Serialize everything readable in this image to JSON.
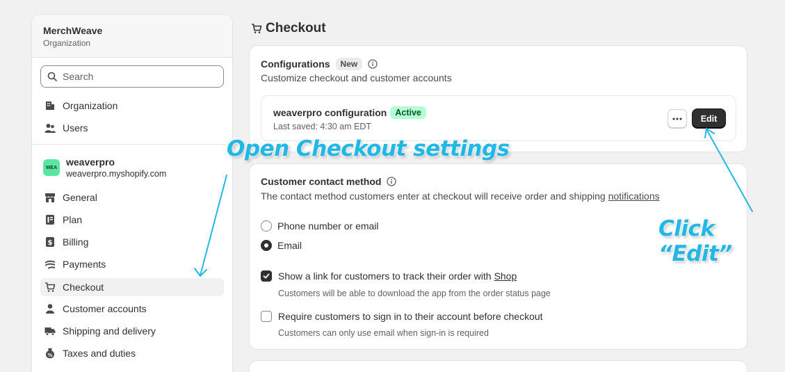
{
  "sidebar": {
    "org_name": "MerchWeave",
    "org_subtitle": "Organization",
    "search_placeholder": "Search",
    "top_items": [
      {
        "label": "Organization",
        "icon": "building-icon"
      },
      {
        "label": "Users",
        "icon": "users-icon"
      }
    ],
    "store": {
      "badge": "WEA",
      "name": "weaverpro",
      "domain": "weaverpro.myshopify.com",
      "badge_color": "#5ae6a0"
    },
    "store_items": [
      {
        "label": "General",
        "icon": "store-icon"
      },
      {
        "label": "Plan",
        "icon": "plan-icon"
      },
      {
        "label": "Billing",
        "icon": "billing-icon"
      },
      {
        "label": "Payments",
        "icon": "payments-icon"
      },
      {
        "label": "Checkout",
        "icon": "cart-icon",
        "active": true
      },
      {
        "label": "Customer accounts",
        "icon": "person-icon"
      },
      {
        "label": "Shipping and delivery",
        "icon": "truck-icon"
      },
      {
        "label": "Taxes and duties",
        "icon": "taxes-icon"
      }
    ]
  },
  "main": {
    "page_title": "Checkout",
    "configurations": {
      "title": "Configurations",
      "new_badge": "New",
      "subtitle": "Customize checkout and customer accounts",
      "config_name": "weaverpro configuration",
      "status_badge": "Active",
      "last_saved": "Last saved: 4:30 am EDT",
      "edit_label": "Edit"
    },
    "contact": {
      "title": "Customer contact method",
      "description": "The contact method customers enter at checkout will receive order and shipping",
      "description_link": "notifications",
      "options": [
        "Phone number or email",
        "Email"
      ],
      "selected": "Email",
      "shop_link_label": "Show a link for customers to track their order with",
      "shop_link_word": "Shop",
      "shop_link_help": "Customers will be able to download the app from the order status page",
      "shop_link_checked": true,
      "signin_label": "Require customers to sign in to their account before checkout",
      "signin_help": "Customers can only use email when sign-in is required",
      "signin_checked": false
    }
  },
  "annotations": {
    "open_checkout": "Open Checkout settings",
    "click_edit": "Click “Edit”",
    "color": "#22b8e6"
  },
  "colors": {
    "active_badge_bg": "#b4fed2",
    "active_badge_text": "#0c5132",
    "primary_button": "#303030"
  }
}
